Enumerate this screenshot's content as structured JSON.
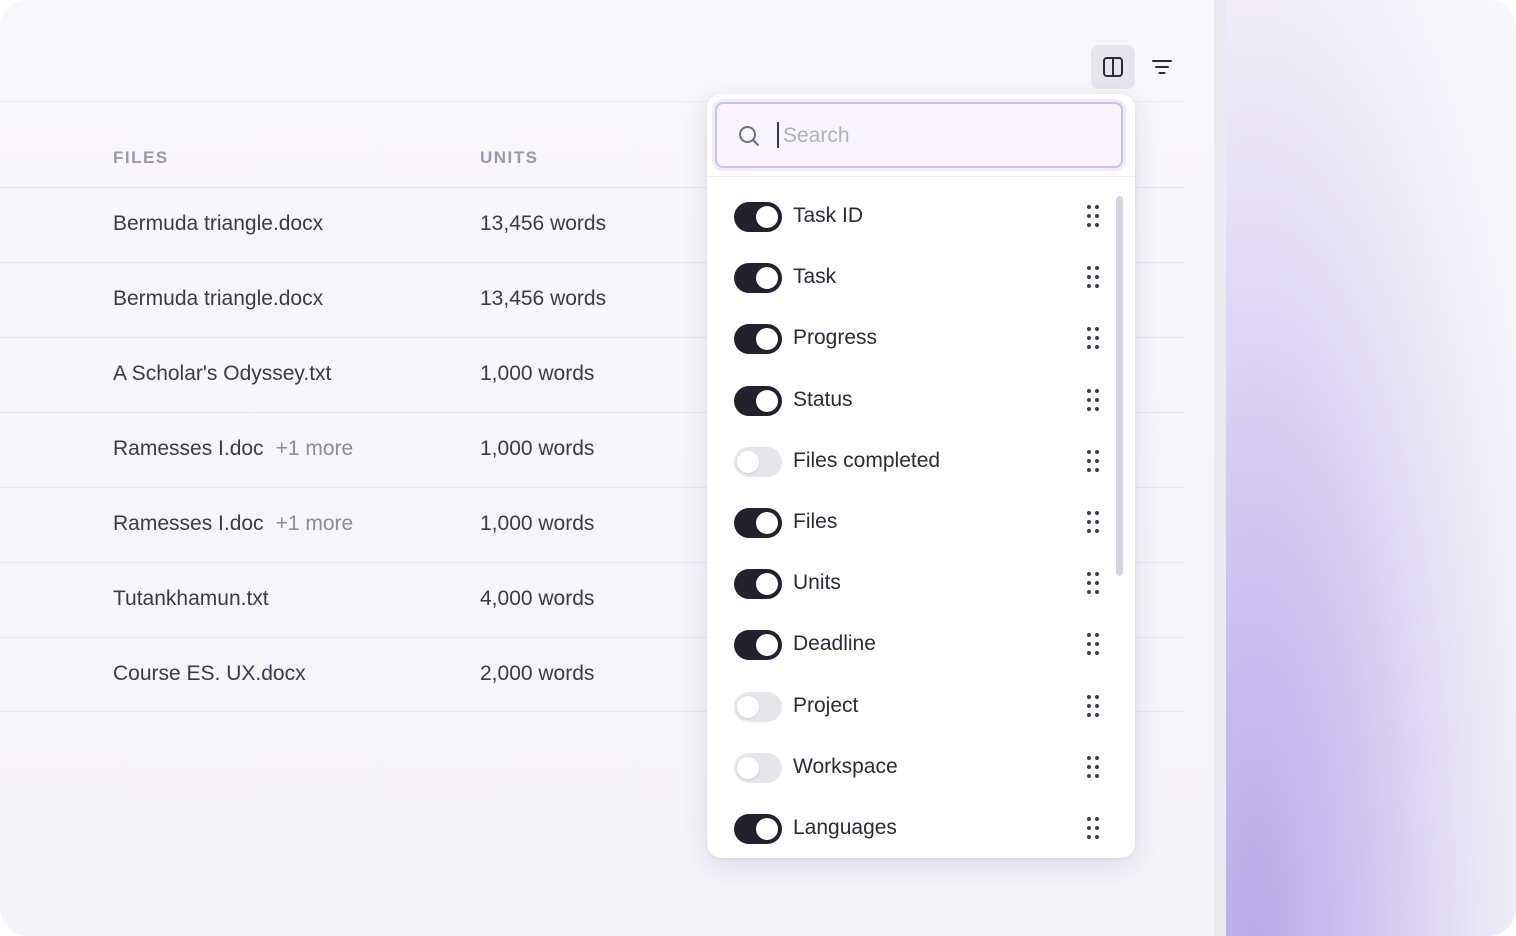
{
  "table": {
    "headers": {
      "files": "FILES",
      "units": "UNITS"
    },
    "rows": [
      {
        "file": "Bermuda triangle.docx",
        "more": "",
        "units": "13,456 words"
      },
      {
        "file": "Bermuda triangle.docx",
        "more": "",
        "units": "13,456 words"
      },
      {
        "file": "A Scholar's Odyssey.txt",
        "more": "",
        "units": "1,000 words"
      },
      {
        "file": "Ramesses I.doc",
        "more": "+1 more",
        "units": "1,000 words"
      },
      {
        "file": "Ramesses I.doc",
        "more": "+1 more",
        "units": "1,000 words"
      },
      {
        "file": "Tutankhamun.txt",
        "more": "",
        "units": "4,000 words"
      },
      {
        "file": "Course ES. UX.docx",
        "more": "",
        "units": "2,000 words"
      }
    ]
  },
  "toolbar": {
    "columns_icon": "columns-icon",
    "filter_icon": "filter-icon"
  },
  "column_picker": {
    "search": {
      "placeholder": "Search",
      "value": ""
    },
    "items": [
      {
        "label": "Task ID",
        "enabled": true
      },
      {
        "label": "Task",
        "enabled": true
      },
      {
        "label": "Progress",
        "enabled": true
      },
      {
        "label": "Status",
        "enabled": true
      },
      {
        "label": "Files completed",
        "enabled": false
      },
      {
        "label": "Files",
        "enabled": true
      },
      {
        "label": "Units",
        "enabled": true
      },
      {
        "label": "Deadline",
        "enabled": true
      },
      {
        "label": "Project",
        "enabled": false
      },
      {
        "label": "Workspace",
        "enabled": false
      },
      {
        "label": "Languages",
        "enabled": true
      }
    ]
  },
  "colors": {
    "toggle_on": "#22212e",
    "toggle_off": "#e6e5ea",
    "accent_border": "#c9bff0"
  }
}
